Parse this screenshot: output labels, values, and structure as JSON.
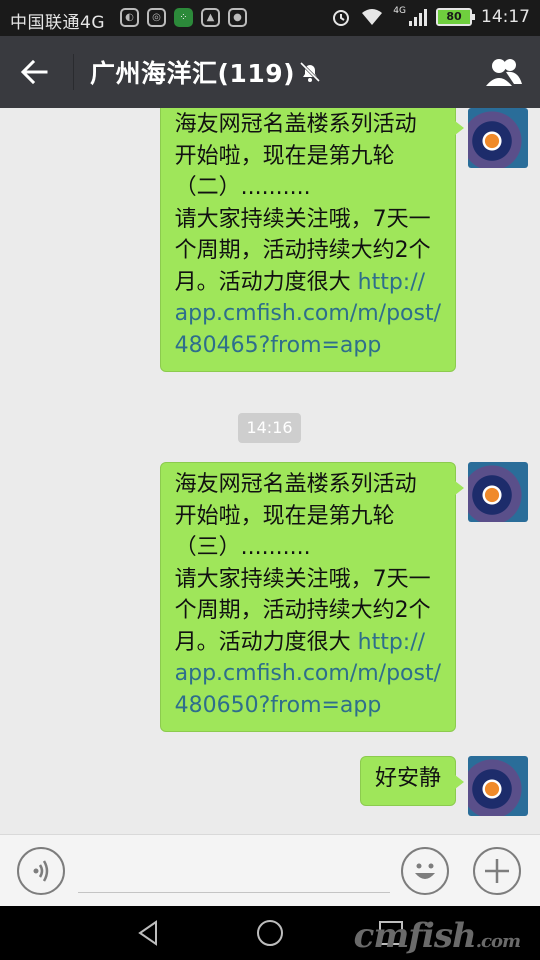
{
  "status_bar": {
    "carrier": "中国联通4G",
    "network_badge": "4G",
    "battery": "80",
    "time": "14:17",
    "app_icons": [
      "cloud-sync-icon",
      "browser-icon",
      "app-grid-icon",
      "photo-icon",
      "chat-bubble-icon"
    ]
  },
  "header": {
    "title": "广州海洋汇(119)"
  },
  "messages": [
    {
      "text": "海友网冠名盖楼系列活动\n开始啦，现在是第九轮\n（二）..........\n请大家持续关注哦，7天一\n个周期，活动持续大约2个\n月。活动力度很大 ",
      "link": "http://\napp.cmfish.com/m/post/\n480465?from=app"
    },
    {
      "text": "海友网冠名盖楼系列活动\n开始啦，现在是第九轮\n（三）..........\n请大家持续关注哦，7天一\n个周期，活动持续大约2个\n月。活动力度很大 ",
      "link": "http://\napp.cmfish.com/m/post/\n480650?from=app"
    },
    {
      "text": "好安静",
      "link": ""
    }
  ],
  "timestamp": "14:16",
  "input": {
    "value": "",
    "placeholder": ""
  },
  "watermark": {
    "brand": "cmfish",
    "suffix": ".com"
  },
  "colors": {
    "bubble": "#9fe65a",
    "header": "#393a3f",
    "link": "#2e6e8c"
  }
}
